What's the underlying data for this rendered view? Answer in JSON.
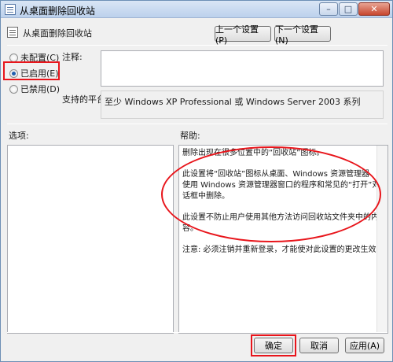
{
  "window": {
    "title": "从桌面删除回收站",
    "controls": {
      "minimize": "–",
      "maximize": "□",
      "close": "✕"
    }
  },
  "header": {
    "policy_name": "从桌面删除回收站",
    "prev_button": "上一个设置(P)",
    "next_button": "下一个设置(N)"
  },
  "state": {
    "options": [
      {
        "label": "未配置(C)",
        "selected": false
      },
      {
        "label": "已启用(E)",
        "selected": true
      },
      {
        "label": "已禁用(D)",
        "selected": false
      }
    ]
  },
  "comment": {
    "label": "注释:",
    "value": ""
  },
  "supported": {
    "label": "支持的平台:",
    "value": "至少 Windows XP Professional 或 Windows Server 2003 系列"
  },
  "options_panel": {
    "label": "选项:"
  },
  "help": {
    "label": "帮助:",
    "paragraphs": [
      "删除出现在很多位置中的“回收站”图标。",
      "此设置将“回收站”图标从桌面、Windows 资源管理器、使用 Windows 资源管理器窗口的程序和常见的“打开”对话框中删除。",
      "此设置不防止用户使用其他方法访问回收站文件夹中的内容。",
      "注意: 必须注销并重新登录，才能使对此设置的更改生效。"
    ]
  },
  "footer": {
    "ok": "确定",
    "cancel": "取消",
    "apply": "应用(A)"
  },
  "colors": {
    "annotation": "#e8151b",
    "radio_selected": "#1f5fae"
  }
}
